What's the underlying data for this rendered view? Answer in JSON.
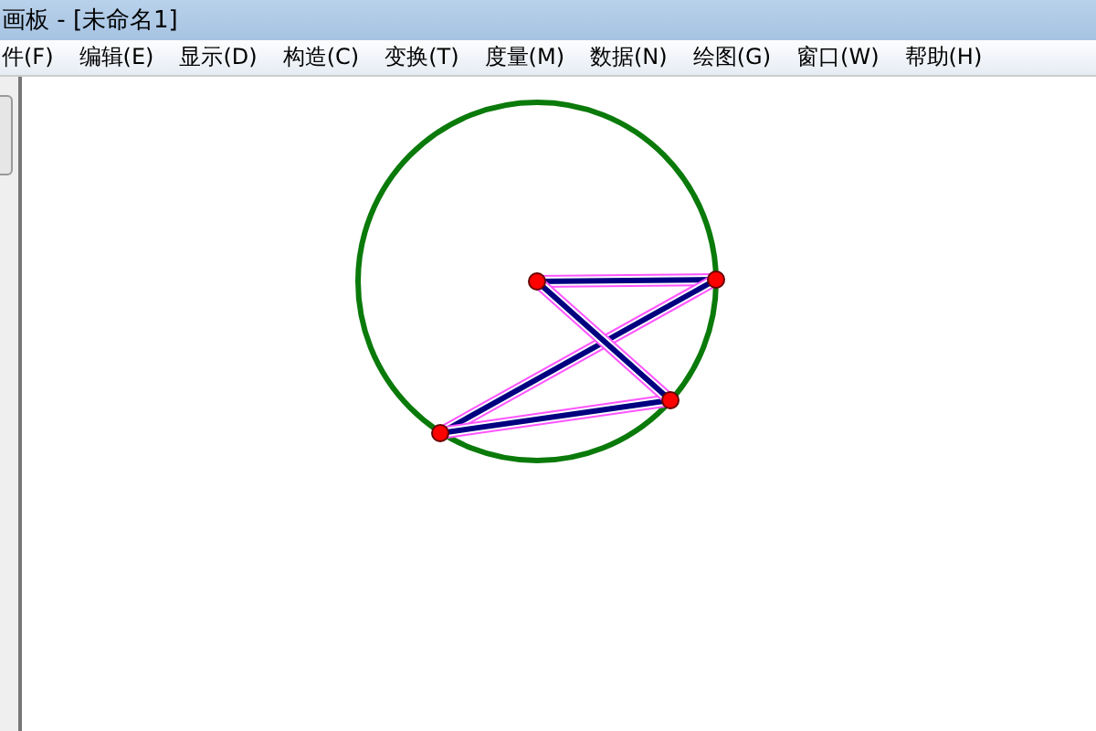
{
  "window": {
    "title": "画板 - [未命名1]"
  },
  "menu": [
    "件(F)",
    "编辑(E)",
    "显示(D)",
    "构造(C)",
    "变换(T)",
    "度量(M)",
    "数据(N)",
    "绘图(G)",
    "窗口(W)",
    "帮助(H)"
  ],
  "segments": [
    {
      "selected": true
    },
    {
      "selected": true
    },
    {
      "selected": true
    },
    {
      "selected": true
    }
  ]
}
